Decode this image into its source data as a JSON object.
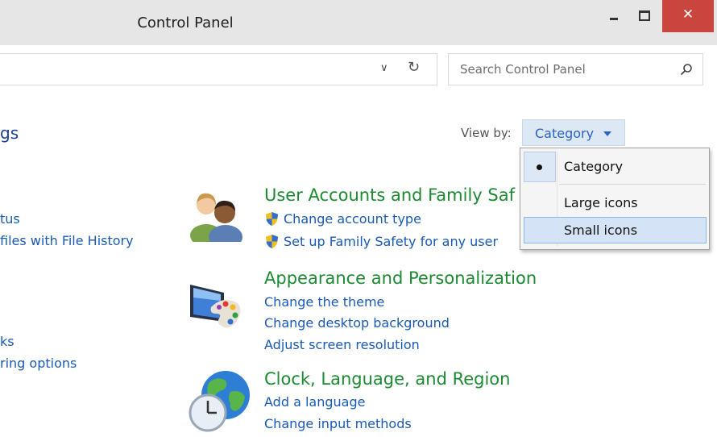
{
  "window": {
    "title": "Control Panel",
    "close_glyph": "✕"
  },
  "search": {
    "placeholder": "Search Control Panel"
  },
  "left_pane": {
    "heading_partial": "gs",
    "links": [
      "tus",
      "files with File History",
      "ks",
      "ring options"
    ]
  },
  "view_by": {
    "label": "View by:",
    "selected": "Category"
  },
  "dropdown": {
    "options": [
      "Category",
      "Large icons",
      "Small icons"
    ],
    "checked": "Category",
    "hovered": "Small icons"
  },
  "categories": [
    {
      "title": "User Accounts and Family Saf",
      "icon": "users-icon",
      "links": [
        "Change account type",
        "Set up Family Safety for any user"
      ]
    },
    {
      "title": "Appearance and Personalization",
      "icon": "monitor-palette-icon",
      "links": [
        "Change the theme",
        "Change desktop background",
        "Adjust screen resolution"
      ]
    },
    {
      "title": "Clock, Language, and Region",
      "icon": "globe-clock-icon",
      "links": [
        "Add a language",
        "Change input methods"
      ]
    }
  ],
  "colors": {
    "link": "#1a5ab7",
    "category_title": "#1c8a31",
    "close_button": "#c9453d"
  }
}
